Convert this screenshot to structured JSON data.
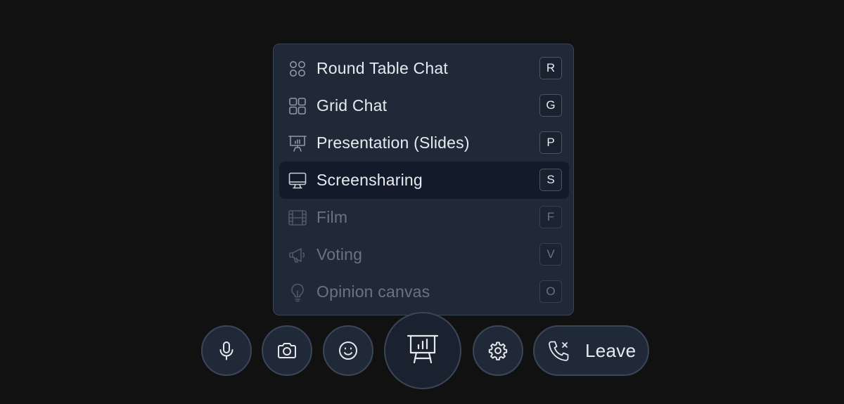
{
  "menu": {
    "items": [
      {
        "label": "Round Table Chat",
        "key": "R",
        "icon": "round-table-icon",
        "state": "enabled"
      },
      {
        "label": "Grid Chat",
        "key": "G",
        "icon": "grid-icon",
        "state": "enabled"
      },
      {
        "label": "Presentation (Slides)",
        "key": "P",
        "icon": "presentation-icon",
        "state": "enabled"
      },
      {
        "label": "Screensharing",
        "key": "S",
        "icon": "monitor-icon",
        "state": "active"
      },
      {
        "label": "Film",
        "key": "F",
        "icon": "film-icon",
        "state": "disabled"
      },
      {
        "label": "Voting",
        "key": "V",
        "icon": "megaphone-icon",
        "state": "disabled"
      },
      {
        "label": "Opinion canvas",
        "key": "O",
        "icon": "lightbulb-icon",
        "state": "disabled"
      }
    ]
  },
  "controls": {
    "microphone": "microphone-icon",
    "camera": "camera-icon",
    "reactions": "smiley-icon",
    "mode": "presentation-icon",
    "settings": "gear-icon",
    "leave_label": "Leave",
    "leave_icon": "phone-x-icon"
  },
  "colors": {
    "background": "#111112",
    "panel": "#1f2937",
    "active_row": "#131b2a",
    "text": "#e7eaef",
    "disabled_text": "#6b7280"
  }
}
